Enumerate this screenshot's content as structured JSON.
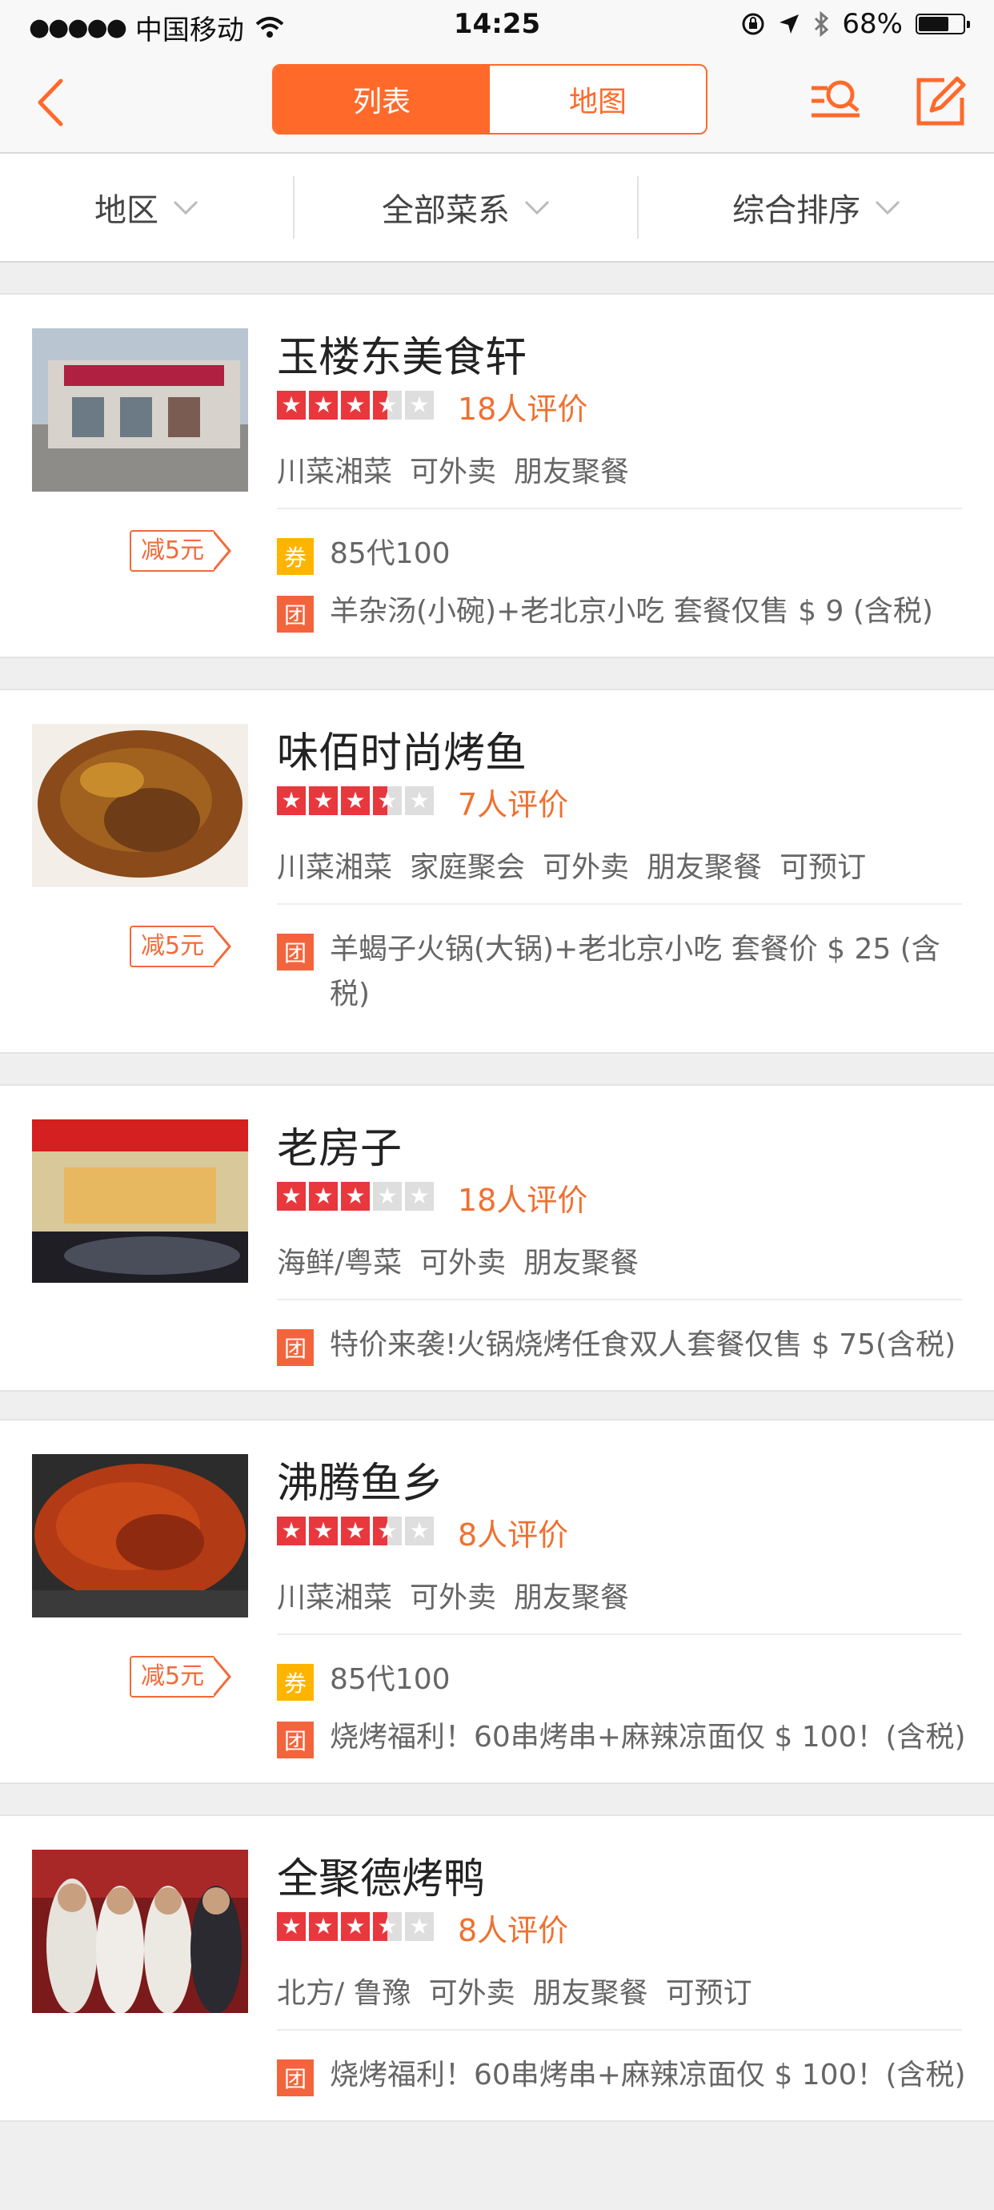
{
  "status": {
    "carrier": "中国移动",
    "time": "14:25",
    "battery": "68%",
    "battery_level": 0.68
  },
  "nav": {
    "tab_list": "列表",
    "tab_map": "地图",
    "active_tab": "list"
  },
  "filters": [
    {
      "label": "地区"
    },
    {
      "label": "全部菜系"
    },
    {
      "label": "综合排序"
    }
  ],
  "restaurants": [
    {
      "name": "玉楼东美食轩",
      "rating": 3.5,
      "reviews": "18人评价",
      "tags": [
        "川菜湘菜",
        "可外卖",
        "朋友聚餐"
      ],
      "discount": "减5元",
      "coupon_badge": "券",
      "coupon": "85代100",
      "group_badge": "团",
      "group": "羊杂汤(小碗)+老北京小吃 套餐仅售 $ 9 (含税)"
    },
    {
      "name": "味佰时尚烤鱼",
      "rating": 3.5,
      "reviews": "7人评价",
      "tags": [
        "川菜湘菜",
        "家庭聚会",
        "可外卖",
        "朋友聚餐",
        "可预订"
      ],
      "discount": "减5元",
      "group_badge": "团",
      "group": "羊蝎子火锅(大锅)+老北京小吃 套餐价 $ 25 (含税)"
    },
    {
      "name": "老房子",
      "rating": 3,
      "reviews": "18人评价",
      "tags": [
        "海鲜/粤菜",
        "可外卖",
        "朋友聚餐"
      ],
      "group_badge": "团",
      "group": "特价来袭!火锅烧烤任食双人套餐仅售 $ 75(含税)"
    },
    {
      "name": "沸腾鱼乡",
      "rating": 3.5,
      "reviews": "8人评价",
      "tags": [
        "川菜湘菜",
        "可外卖",
        "朋友聚餐"
      ],
      "discount": "减5元",
      "coupon_badge": "券",
      "coupon": "85代100",
      "group_badge": "团",
      "group": "烧烤福利！60串烤串+麻辣凉面仅 $ 100！(含税)"
    },
    {
      "name": "全聚德烤鸭",
      "rating": 3.5,
      "reviews": "8人评价",
      "tags": [
        "北方/ 鲁豫",
        "可外卖",
        "朋友聚餐",
        "可预订"
      ],
      "group_badge": "团",
      "group": "烧烤福利！60串烤串+麻辣凉面仅 $ 100！(含税)"
    }
  ],
  "colors": {
    "accent": "#ff6a2b",
    "star": "#e8373d",
    "coupon": "#ffb400",
    "group": "#f4643c"
  }
}
